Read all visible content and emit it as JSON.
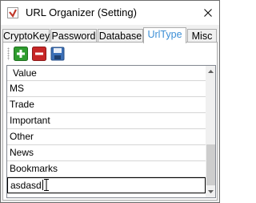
{
  "window": {
    "title": "URL Organizer (Setting)"
  },
  "tabs": [
    {
      "label": "CryptoKey"
    },
    {
      "label": "Password"
    },
    {
      "label": "Database"
    },
    {
      "label": "UrlType",
      "active": true
    },
    {
      "label": "Misc"
    }
  ],
  "toolbar": {
    "add_icon": "add-icon",
    "delete_icon": "delete-icon",
    "save_icon": "save-icon"
  },
  "grid": {
    "column_header": "Value",
    "rows": [
      "MS",
      "Trade",
      "Important",
      "Other",
      "News",
      "Bookmarks"
    ],
    "edit_row_value": "asdasd"
  },
  "colors": {
    "active_tab_text": "#3c8fd6",
    "add_green": "#2e9c2e",
    "delete_red": "#c72626",
    "save_blue": "#3b6fb6"
  }
}
